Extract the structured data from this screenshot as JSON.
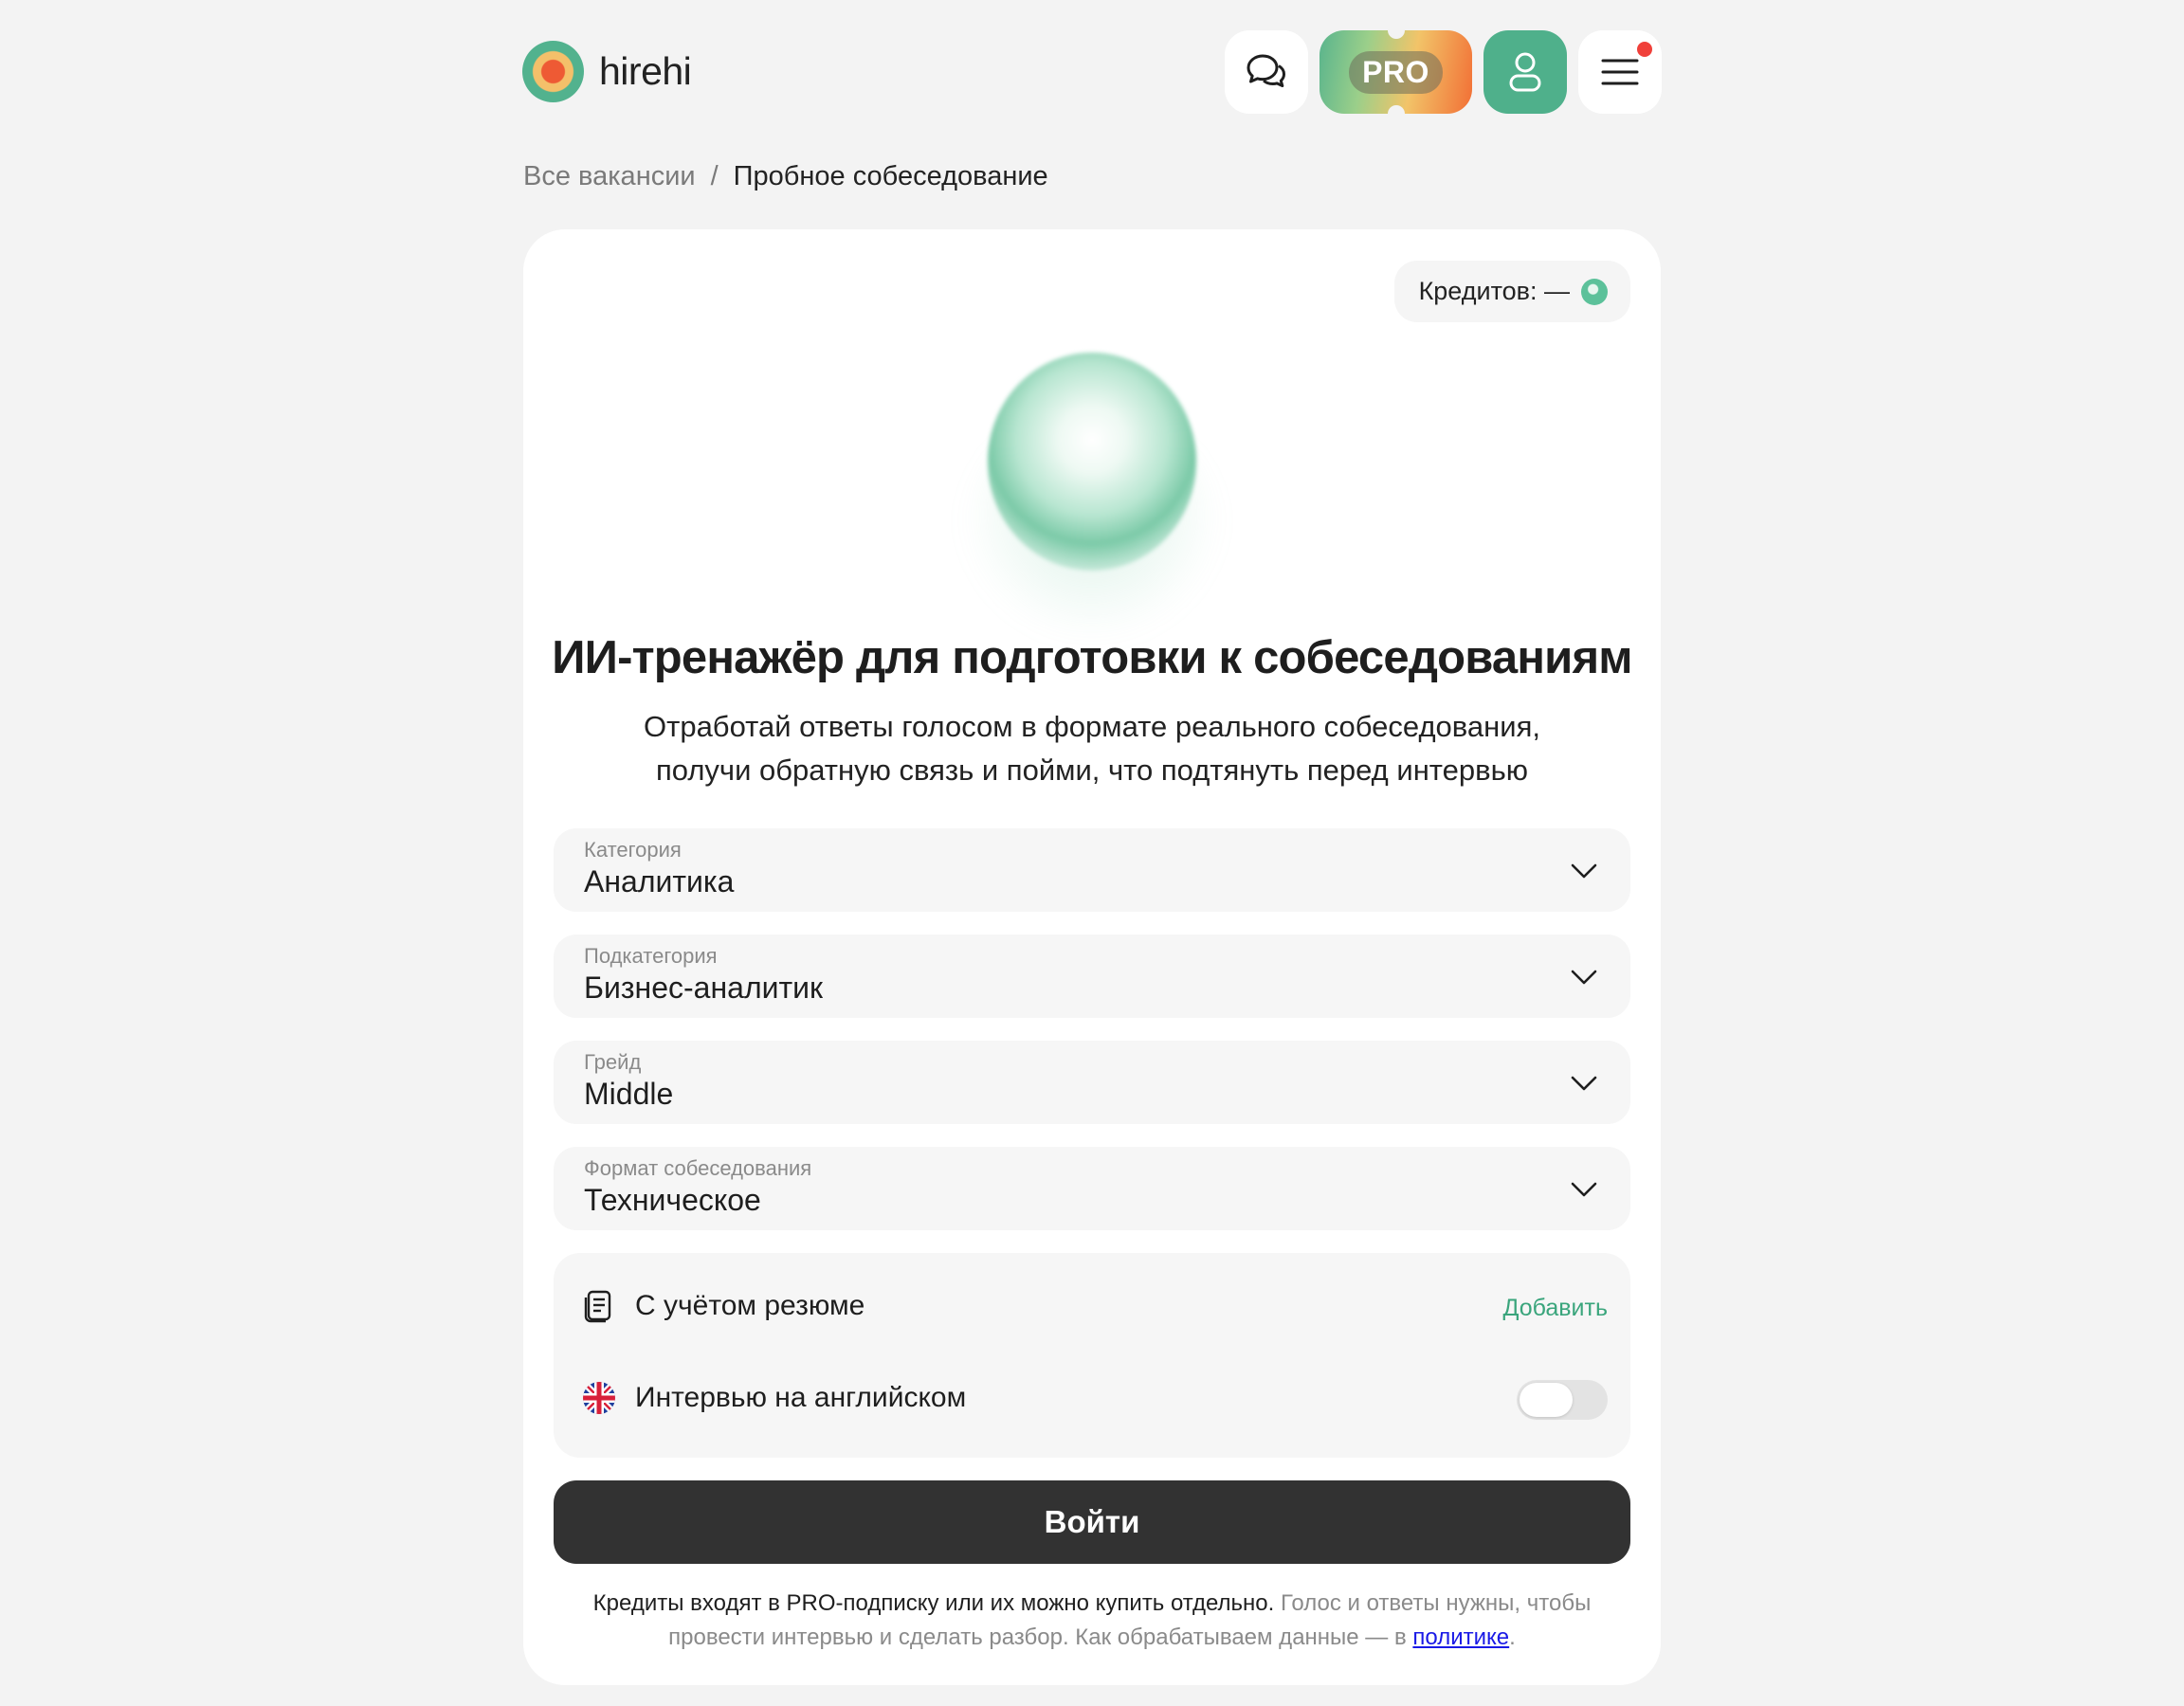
{
  "app": {
    "brand": "hirehi",
    "pro_label": "PRO",
    "accent": "#4fb08b"
  },
  "breadcrumb": {
    "parent": "Все вакансии",
    "separator": "/",
    "current": "Пробное собеседование"
  },
  "credits": {
    "label": "Кредитов: —"
  },
  "hero": {
    "title": "ИИ-тренажёр для подготовки к собеседованиям",
    "subtitle_line1": "Отработай ответы голосом в формате реального собеседования,",
    "subtitle_line2": "получи обратную связь и пойми, что подтянуть перед интервью"
  },
  "form": {
    "category": {
      "label": "Категория",
      "value": "Аналитика"
    },
    "subcategory": {
      "label": "Подкатегория",
      "value": "Бизнес-аналитик"
    },
    "grade": {
      "label": "Грейд",
      "value": "Middle"
    },
    "format": {
      "label": "Формат собеседования",
      "value": "Техническое"
    }
  },
  "options": {
    "resume_label": "С учётом резюме",
    "resume_action": "Добавить",
    "english_label": "Интервью на английском",
    "english_enabled": false
  },
  "submit": {
    "label": "Войти"
  },
  "footnote": {
    "strong": "Кредиты входят в PRO-подписку или их можно купить отдельно.",
    "rest": " Голос и ответы нужны, чтобы провести интервью и сделать разбор. Как обрабатываем данные — в ",
    "link": "политике",
    "end": "."
  },
  "icons": {
    "chat": "chat-bubbles-icon",
    "profile": "user-icon",
    "menu": "hamburger-menu-icon",
    "resume": "document-icon",
    "english": "uk-flag-icon",
    "chevron": "chevron-down-icon",
    "coin": "credit-coin-icon"
  }
}
